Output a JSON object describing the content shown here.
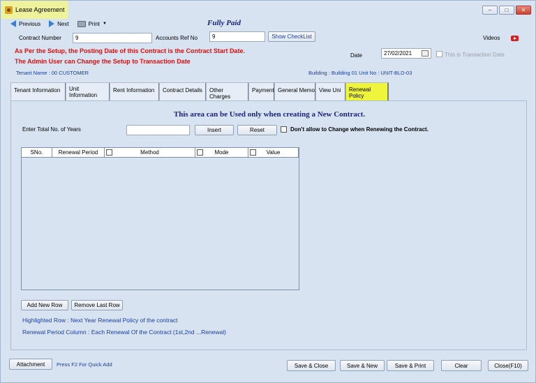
{
  "window": {
    "title": "Lease Agreement",
    "controls": [
      "–",
      "□",
      "✕"
    ]
  },
  "toolbar": {
    "previous_label": "Previous",
    "next_label": "Next",
    "print_label": "Print"
  },
  "status_banner": "Fully Paid",
  "form": {
    "contract_number_label": "Contract Number",
    "contract_number_value": "9",
    "accounts_ref_label": "Accounts Ref No",
    "accounts_ref_value": "9",
    "show_checklist_label": "Show CheckList",
    "videos_label": "Videos",
    "date_label": "Date",
    "date_value": "27/02/2021",
    "transaction_date_label": "This is Transaction Date",
    "warning_line1": "As Per the Setup, the Posting Date of this Contract is the Contract Start Date.",
    "warning_line2": "The Admin User can Change the Setup to Transaction Date",
    "tenant_name": "Tenant Name : 00 CUSTOMER",
    "building_unit": "Building : Building 01  Unit No : UNIT-BLD-03"
  },
  "tabs": [
    {
      "label": "Tenant Information"
    },
    {
      "label": "Unit Information"
    },
    {
      "label": "Rent Information"
    },
    {
      "label": "Contract Details"
    },
    {
      "label": "Other Charges"
    },
    {
      "label": "Payment"
    },
    {
      "label": "General Memo"
    },
    {
      "label": "View Uni"
    },
    {
      "label": "Renewal Policy"
    }
  ],
  "renewal": {
    "heading": "This area can be Used only when creating a New Contract.",
    "years_label": "Enter Total No. of Years",
    "years_value": "",
    "insert_label": "Insert",
    "reset_label": "Reset",
    "dont_allow_label": "Don't allow to Change when Renewing the Contract.",
    "columns": [
      "SNo.",
      "Renewal Period",
      "Method",
      "Mode",
      "Value"
    ],
    "add_row_label": "Add New Row",
    "remove_row_label": "Remove Last Row",
    "note1": "Highlighted Row : Next Year Renewal Policy of the contract",
    "note2": "Renewal Period Column : Each Renewal Of the Contract (1st,2nd ...Renewal)"
  },
  "footer": {
    "attachment_label": "Attachment",
    "quick_add_hint": "Press F2 For Quick Add",
    "save_close_label": "Save & Close",
    "save_new_label": "Save & New",
    "save_print_label": "Save & Print",
    "clear_label": "Clear",
    "close_label": "Close(F10)"
  },
  "colors": {
    "window_bg": "#d7e3f1",
    "title_tab": "#eef29a",
    "active_tab": "#eef53a",
    "warning": "#e01010",
    "info_blue": "#1a3ea8",
    "heading_navy": "#1a237e"
  }
}
